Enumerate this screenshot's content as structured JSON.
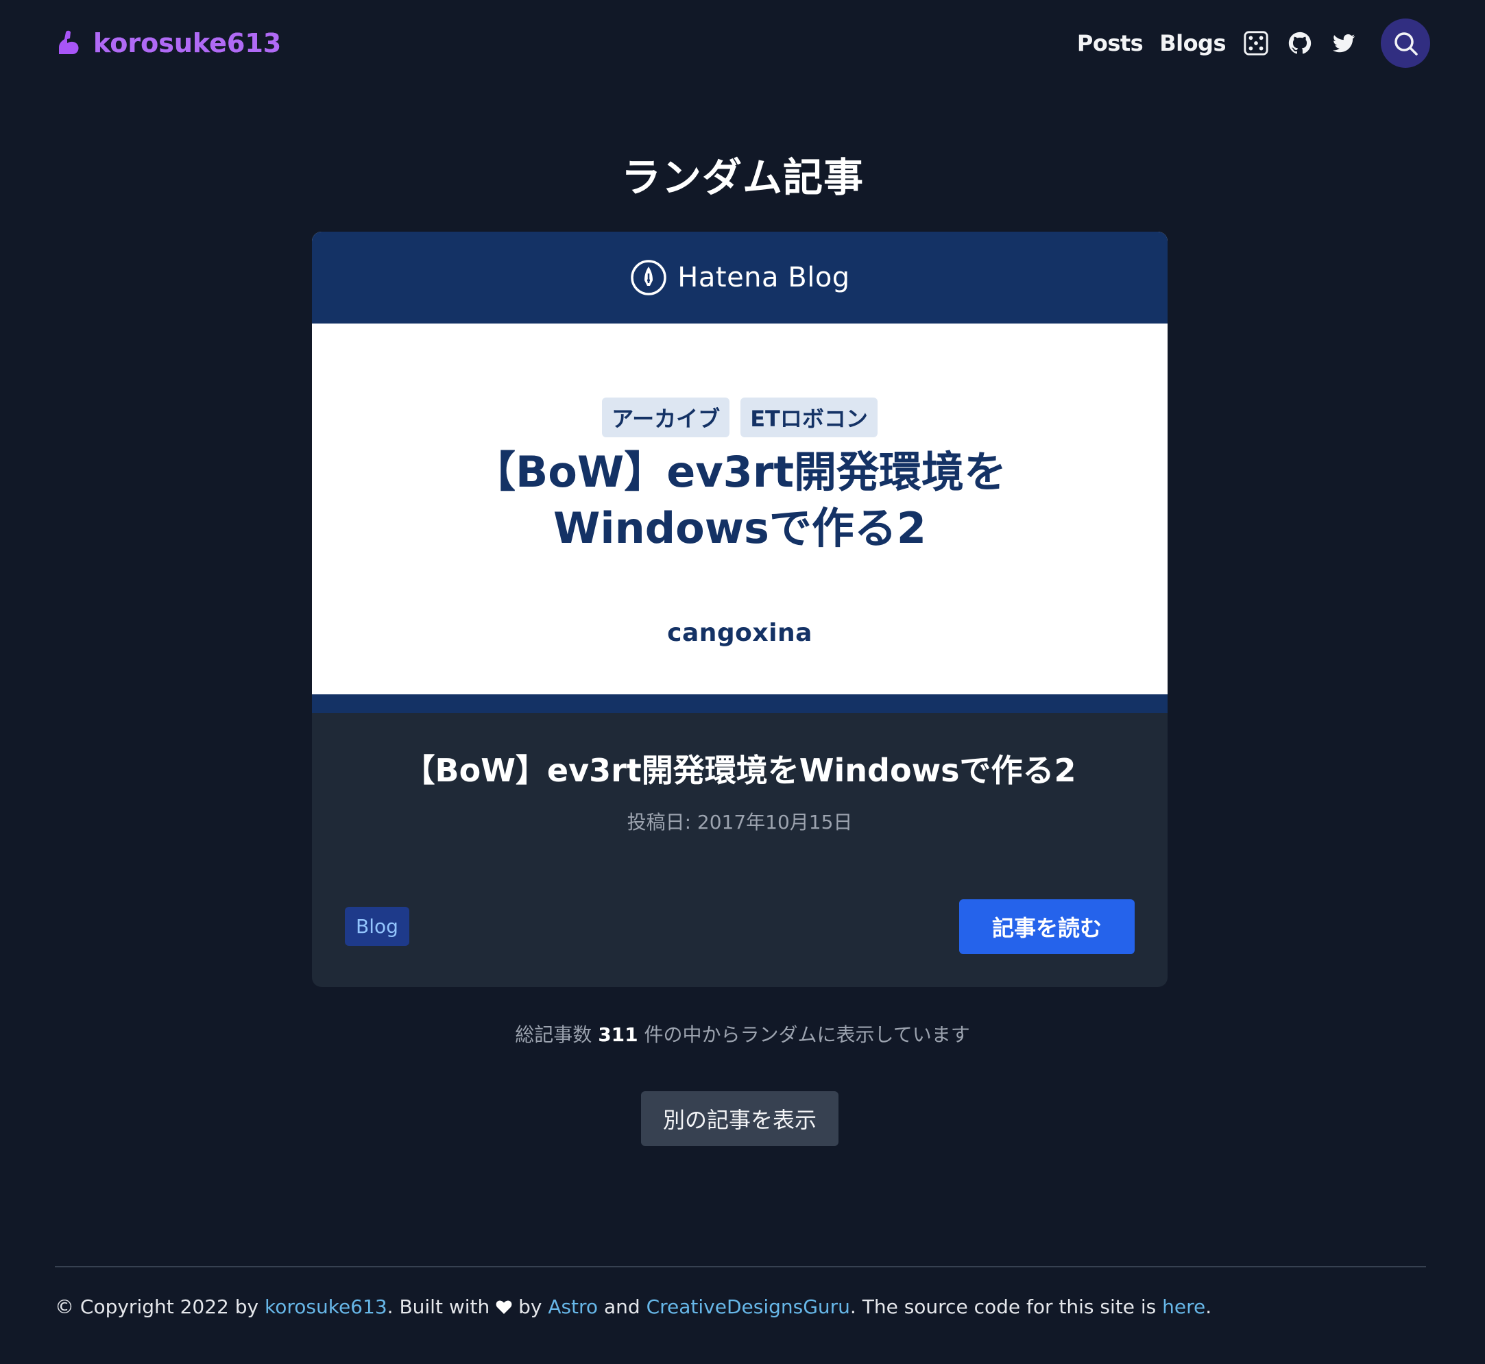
{
  "header": {
    "site_name": "korosuke613",
    "nav": [
      {
        "label": "Posts"
      },
      {
        "label": "Blogs"
      }
    ],
    "icons": [
      "dice-icon",
      "github-icon",
      "twitter-icon",
      "search-icon"
    ],
    "accent_color": "#a855f7"
  },
  "page_title": "ランダム記事",
  "card": {
    "image": {
      "brand": "Hatena Blog",
      "tags": [
        "アーカイブ",
        "ETロボコン"
      ],
      "title_line1": "【BoW】ev3rt開発環境を",
      "title_line2": "Windowsで作る2",
      "author": "cangoxina",
      "brand_color": "#143265"
    },
    "title": "【BoW】ev3rt開発環境をWindowsで作る2",
    "date": "投稿日: 2017年10月15日",
    "badge": "Blog",
    "read_button": "記事を読む"
  },
  "summary": {
    "prefix": "総記事数",
    "count": "311",
    "suffix": "件の中からランダムに表示しています"
  },
  "another_button": "別の記事を表示",
  "footer": {
    "copyright": "© Copyright 2022 by",
    "author_link": "korosuke613",
    "built_with": ". Built with",
    "by": "by",
    "astro_link": "Astro",
    "and": "and",
    "cdg_link": "CreativeDesignsGuru",
    "source_text": ". The source code for this site is",
    "here_link": "here",
    "end": "."
  }
}
